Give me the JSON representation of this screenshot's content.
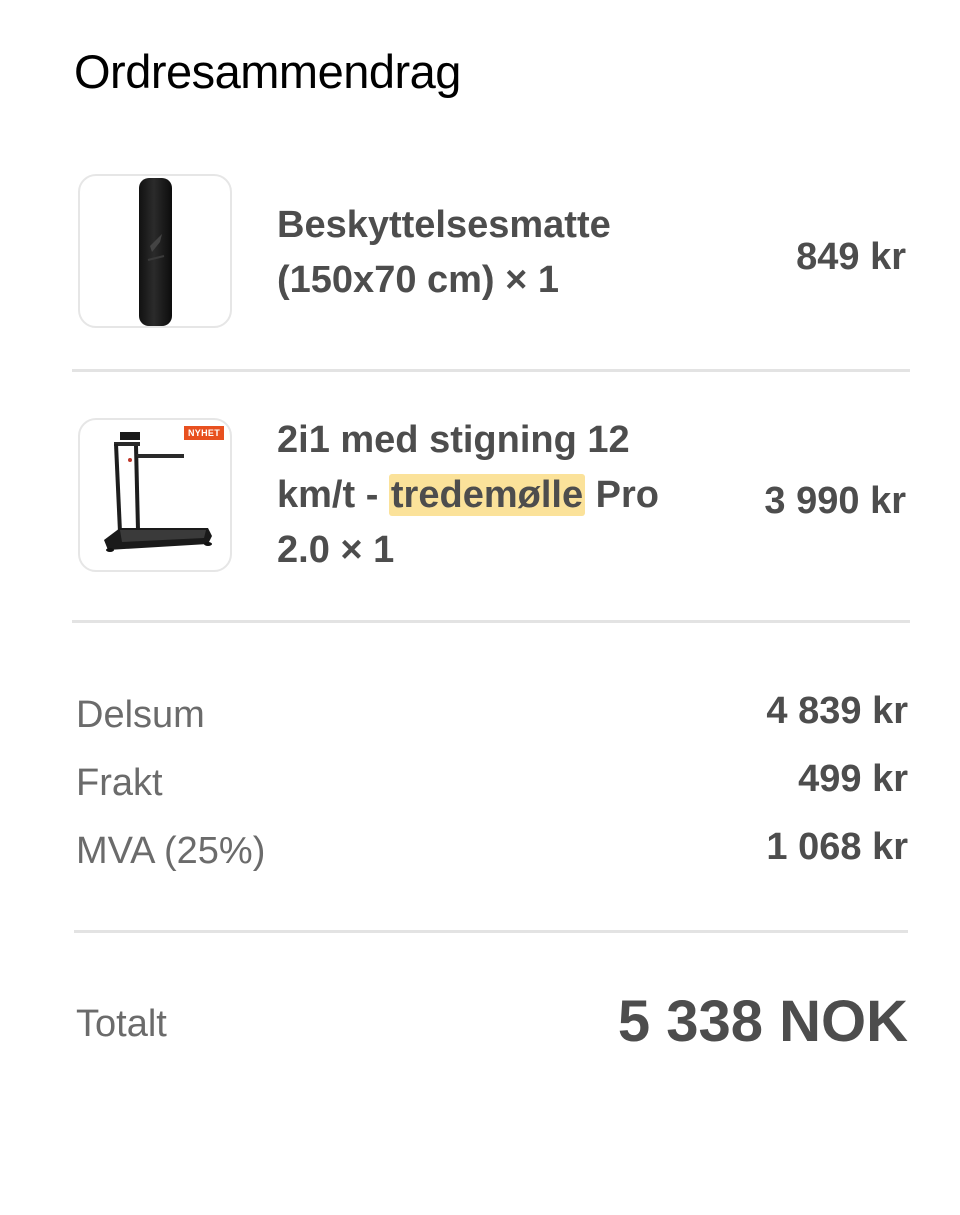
{
  "order_summary": {
    "title": "Ordresammendrag",
    "items": [
      {
        "image": "protective-mat-rolled",
        "name": "Beskyttelsesmatte (150x70 cm) × 1",
        "price": "849 kr"
      },
      {
        "image": "treadmill",
        "badge": "NYHET",
        "name_before": "2i1 med stigning 12 km/t - ",
        "name_highlight": "tredemølle",
        "name_after": " Pro 2.0 × 1",
        "price": "3 990 kr"
      }
    ],
    "summary": {
      "subtotal_label": "Delsum",
      "subtotal_value": "4 839 kr",
      "shipping_label": "Frakt",
      "shipping_value": "499 kr",
      "vat_label": "MVA (25%)",
      "vat_value": "1 068 kr"
    },
    "total_label": "Totalt",
    "total_value": "5 338 NOK",
    "colors": {
      "highlight": "#fbe29a",
      "badge": "#e8501f",
      "divider": "#e3e3e3"
    }
  }
}
